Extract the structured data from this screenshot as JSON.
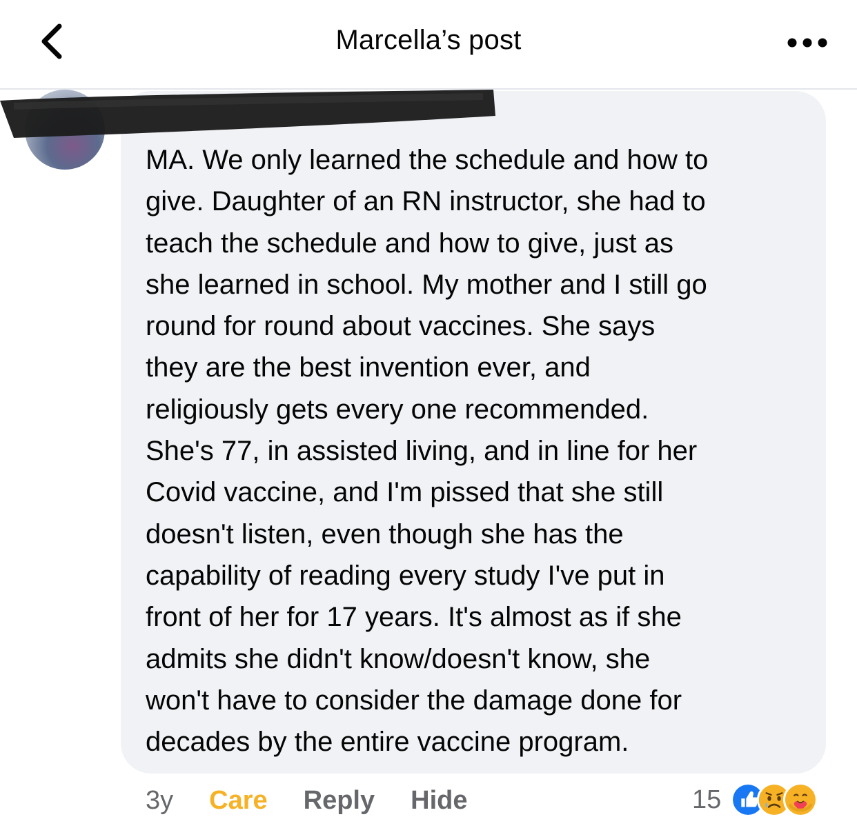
{
  "header": {
    "title": "Marcella’s post",
    "back_icon": "chevron-left-icon",
    "more_icon": "ellipsis-icon"
  },
  "comment": {
    "text": "MA. We only learned the schedule and how to\ngive. Daughter of an RN instructor,  she had to\nteach the schedule and how to give, just as\nshe learned in school. My mother and I still go\nround for round about vaccines.  She says\nthey are the best invention ever, and\nreligiously gets every one recommended.\nShe's 77, in assisted living,  and in line for her\nCovid vaccine,  and I'm pissed that she still\ndoesn't listen,  even though she has the\ncapability of reading every study I've put in\nfront of her for 17 years. It's almost as if she\nadmits she didn't know/doesn't know, she\nwon't have to consider the damage done for\ndecades by the entire vaccine program."
  },
  "actions": {
    "timestamp": "3y",
    "care_label": "Care",
    "reply_label": "Reply",
    "hide_label": "Hide"
  },
  "reactions": {
    "count": "15",
    "icons": [
      "like-icon",
      "sad-icon",
      "care-icon"
    ]
  },
  "colors": {
    "bubble_bg": "#f0f2f5",
    "care_accent": "#f7b125",
    "like_blue": "#1877f2",
    "muted_text": "#65676b"
  }
}
